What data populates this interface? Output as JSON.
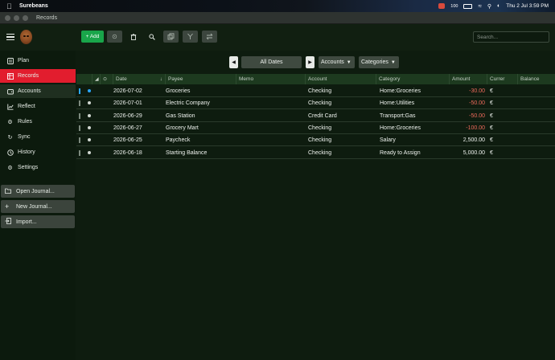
{
  "menubar": {
    "app_name": "Surebeans",
    "clock": "Thu 2 Jul  3:59 PM",
    "battery": "100"
  },
  "window": {
    "title": "Records"
  },
  "toolbar": {
    "add_label": "+ Add",
    "search_placeholder": "Search..."
  },
  "sidebar": {
    "items": [
      {
        "label": "Plan",
        "icon": "list-icon"
      },
      {
        "label": "Records",
        "icon": "table-icon"
      },
      {
        "label": "Accounts",
        "icon": "wallet-icon"
      },
      {
        "label": "Reflect",
        "icon": "chart-icon"
      },
      {
        "label": "Rules",
        "icon": "gear-icon"
      },
      {
        "label": "Sync",
        "icon": "sync-icon"
      },
      {
        "label": "History",
        "icon": "clock-icon"
      },
      {
        "label": "Settings",
        "icon": "settings-icon"
      }
    ],
    "buttons": [
      {
        "label": "Open Journal...",
        "icon": "folder-icon"
      },
      {
        "label": "New Journal...",
        "icon": "plus-icon"
      },
      {
        "label": "Import...",
        "icon": "import-icon"
      }
    ]
  },
  "filters": {
    "date_range": "All Dates",
    "accounts": "Accounts",
    "categories": "Categories"
  },
  "table": {
    "headers": [
      "Date",
      "Payee",
      "Memo",
      "Account",
      "Category",
      "Amount",
      "Currer",
      "Balance"
    ],
    "rows": [
      {
        "date": "2026-07-02",
        "payee": "Groceries",
        "memo": "",
        "account": "Checking",
        "category": "Home:Groceries",
        "amount": "-30.00",
        "currency": "€",
        "balance": "",
        "selected": true
      },
      {
        "date": "2026-07-01",
        "payee": "Electric Company",
        "memo": "",
        "account": "Checking",
        "category": "Home:Utilities",
        "amount": "-50.00",
        "currency": "€",
        "balance": "",
        "selected": false
      },
      {
        "date": "2026-06-29",
        "payee": "Gas Station",
        "memo": "",
        "account": "Credit Card",
        "category": "Transport:Gas",
        "amount": "-50.00",
        "currency": "€",
        "balance": "",
        "selected": false
      },
      {
        "date": "2026-06-27",
        "payee": "Grocery Mart",
        "memo": "",
        "account": "Checking",
        "category": "Home:Groceries",
        "amount": "-100.00",
        "currency": "€",
        "balance": "",
        "selected": false
      },
      {
        "date": "2026-06-25",
        "payee": "Paycheck",
        "memo": "",
        "account": "Checking",
        "category": "Salary",
        "amount": "2,500.00",
        "currency": "€",
        "balance": "",
        "selected": false
      },
      {
        "date": "2026-06-18",
        "payee": "Starting Balance",
        "memo": "",
        "account": "Checking",
        "category": "Ready to Assign",
        "amount": "5,000.00",
        "currency": "€",
        "balance": "",
        "selected": false
      }
    ]
  },
  "colors": {
    "accent_add": "#19a54a",
    "active_nav": "#e21d2e",
    "negative_amount": "#ee6a5c",
    "background": "#0e1c0f"
  }
}
